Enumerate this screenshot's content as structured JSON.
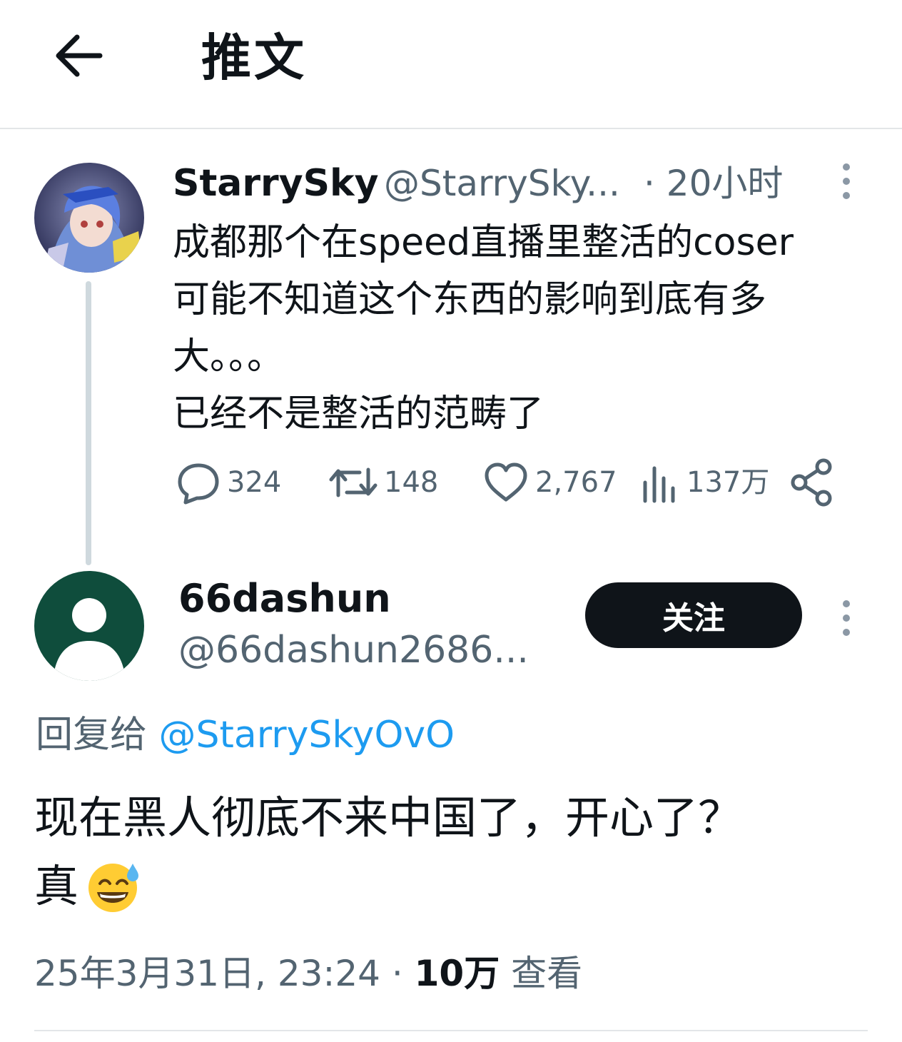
{
  "header": {
    "title": "推文"
  },
  "parent_tweet": {
    "name": "StarrySky",
    "handle": "@StarrySky...",
    "time": "· 20小时",
    "text": "成都那个在speed直播里整活的coser\n可能不知道这个东西的影响到底有多\n大。。。\n已经不是整活的范畴了",
    "actions": {
      "replies": "324",
      "retweets": "148",
      "likes": "2,767",
      "views": "137万"
    }
  },
  "reply_tweet": {
    "name": "66dashun",
    "handle": "@66dashun2686...",
    "follow_label": "关注",
    "reply_to_prefix": "回复给 ",
    "reply_to_handle": "@StarrySkyOvO",
    "text": "现在黑人彻底不来中国了，开心了？\n真",
    "meta_date": "25年3月31日, 23:24 · ",
    "meta_views_count": "10万",
    "meta_views_label": " 查看"
  },
  "colors": {
    "secondary_text": "#536471",
    "link": "#1d9bf0",
    "default_avatar_bg": "#0f4d3c",
    "follow_button_bg": "#0f1419"
  },
  "icons": [
    "back-arrow-icon",
    "more-vertical-icon",
    "reply-icon",
    "retweet-icon",
    "like-icon",
    "views-icon",
    "share-icon",
    "sweat-smile-emoji"
  ]
}
